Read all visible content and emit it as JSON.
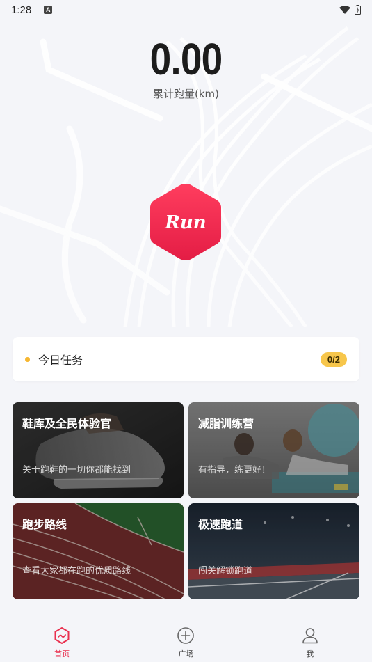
{
  "status_bar": {
    "time": "1:28",
    "notif_letter": "A"
  },
  "stats": {
    "distance_value": "0.00",
    "distance_label": "累计跑量(km)"
  },
  "logo": {
    "text": "Run"
  },
  "task": {
    "title": "今日任务",
    "progress": "0/2"
  },
  "tiles": [
    {
      "title": "鞋库及全民体验官",
      "subtitle": "关于跑鞋的一切你都能找到"
    },
    {
      "title": "减脂训练营",
      "subtitle": "有指导，练更好！"
    },
    {
      "title": "跑步路线",
      "subtitle": "查看大家都在跑的优质路线"
    },
    {
      "title": "极速跑道",
      "subtitle": "闯关解锁跑道"
    }
  ],
  "nav": [
    {
      "label": "首页",
      "icon": "home-run-icon",
      "active": true
    },
    {
      "label": "广场",
      "icon": "plus-circle-icon",
      "active": false
    },
    {
      "label": "我",
      "icon": "user-icon",
      "active": false
    }
  ],
  "colors": {
    "accent": "#e9304f",
    "badge": "#f7c64b",
    "background": "#f4f5f9"
  }
}
